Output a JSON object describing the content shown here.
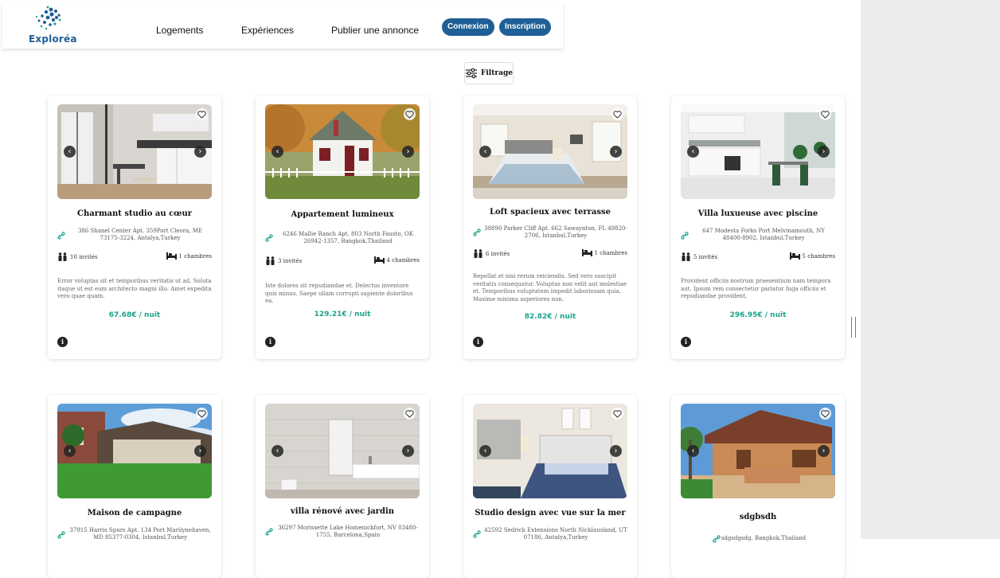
{
  "brand": {
    "name": "Exploréa",
    "primary": "#1e5f96",
    "accent": "#1aa38b"
  },
  "nav": {
    "links": [
      "Logements",
      "Expériences",
      "Publier une annonce"
    ],
    "login": "Connexion",
    "signup": "Inscription"
  },
  "filter": {
    "label": "Filtrage",
    "icon": "sliders-icon"
  },
  "cards": [
    {
      "title": "Charmant studio au cœur",
      "address": "386 Shanel Center Apt. 359Port Cleora, ME 73175-3224, Antalya,Turkey",
      "guests": "10 invités",
      "rooms": "1 chambres",
      "description": "Error voluptas sit et temporibus veritatis ut ad. Soluta itaque ut est eum architecto magni illo. Amet expedita vero quae quam.",
      "price": "67.68€ / nuit"
    },
    {
      "title": "Appartement lumineux",
      "address": "6246 Mallie Ranch Apt. 803 North Fausto, OK 26942-1357, Bangkok,Thailand",
      "guests": "3 invités",
      "rooms": "4 chambres",
      "description": "Iste dolores sit repudiandae et. Delectus inventore quis minus. Saepe ullam corrupti sapiente doloribus ea.",
      "price": "129.21€ / nuit"
    },
    {
      "title": "Loft spacieux avec terrasse",
      "address": "38890 Parker Cliff Apt. 662 Sawaynton, FL 49820-2706, Istanbul,Turkey",
      "guests": "6 invités",
      "rooms": "1 chambres",
      "description": "Repellat et nisi rerum reiciendis. Sed vero suscipit veritatis consequatur. Voluptas non velit aut molestiae et. Temporibus voluptatem impedit laboriosam quia. Maxime minima asperiores non.",
      "price": "82.82€ / nuit"
    },
    {
      "title": "Villa luxueuse avec piscine",
      "address": "647 Modesta Forks Port Melvinamouth, NY 48400-8902, Istanbul,Turkey",
      "guests": "5 invités",
      "rooms": "5 chambres",
      "description": "Provident officiis nostrum praesentium nam tempora aut. Ipsum rem consectetur pariatur fuga officiis et repudiandae provident.",
      "price": "296.95€ / nuit"
    },
    {
      "title": "Maison de campagne",
      "address": "37915 Harris Spurs Apt. 134 Port Marilynehaven, MD 85377-0304, Istanbul,Turkey"
    },
    {
      "title": "villa rénové avec jardin",
      "address": "36297 Morissette Lake Homenickfort, NV 03480-1755, Barcelona,Spain"
    },
    {
      "title": "Studio design avec vue sur la mer",
      "address": "42592 Sedrick Extensions North Nicklausland, UT 07186, Antalya,Turkey"
    },
    {
      "title": "sdgbsdh",
      "address": "sdgsdgsdg, Bangkok,Thailand"
    }
  ]
}
